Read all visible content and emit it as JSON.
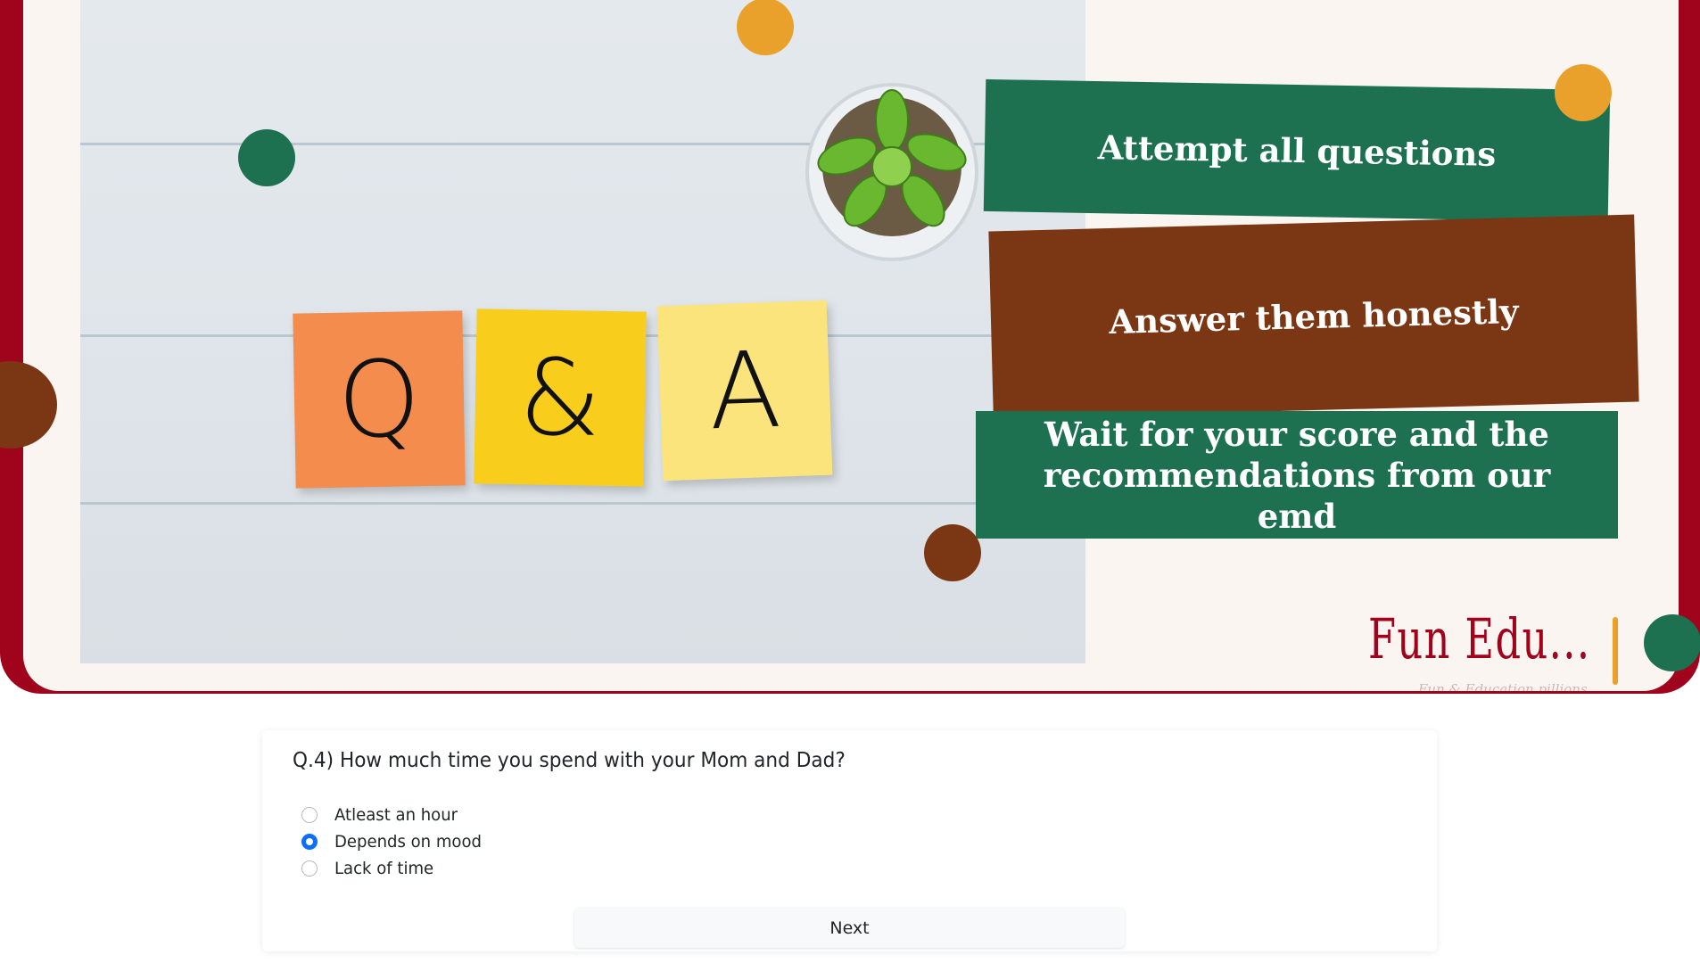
{
  "hero": {
    "photo_notes": [
      "Q",
      "&",
      "A"
    ],
    "banners": [
      "Attempt all questions",
      "Answer them honestly",
      "Wait for your score and the recommendations from our emd"
    ],
    "logo": {
      "name": "Fun Edu...",
      "tagline": "Fun & Education pillions"
    }
  },
  "quiz": {
    "question": "Q.4) How much time you spend with your Mom and Dad?",
    "options": [
      "Atleast an hour",
      "Depends on mood",
      "Lack of time"
    ],
    "selected_index": 1,
    "next_label": "Next"
  },
  "colors": {
    "brand_red": "#a0031c",
    "green": "#1e7150",
    "brown": "#7b3713",
    "orange": "#e9a12b",
    "accent_blue": "#0d6efd"
  }
}
